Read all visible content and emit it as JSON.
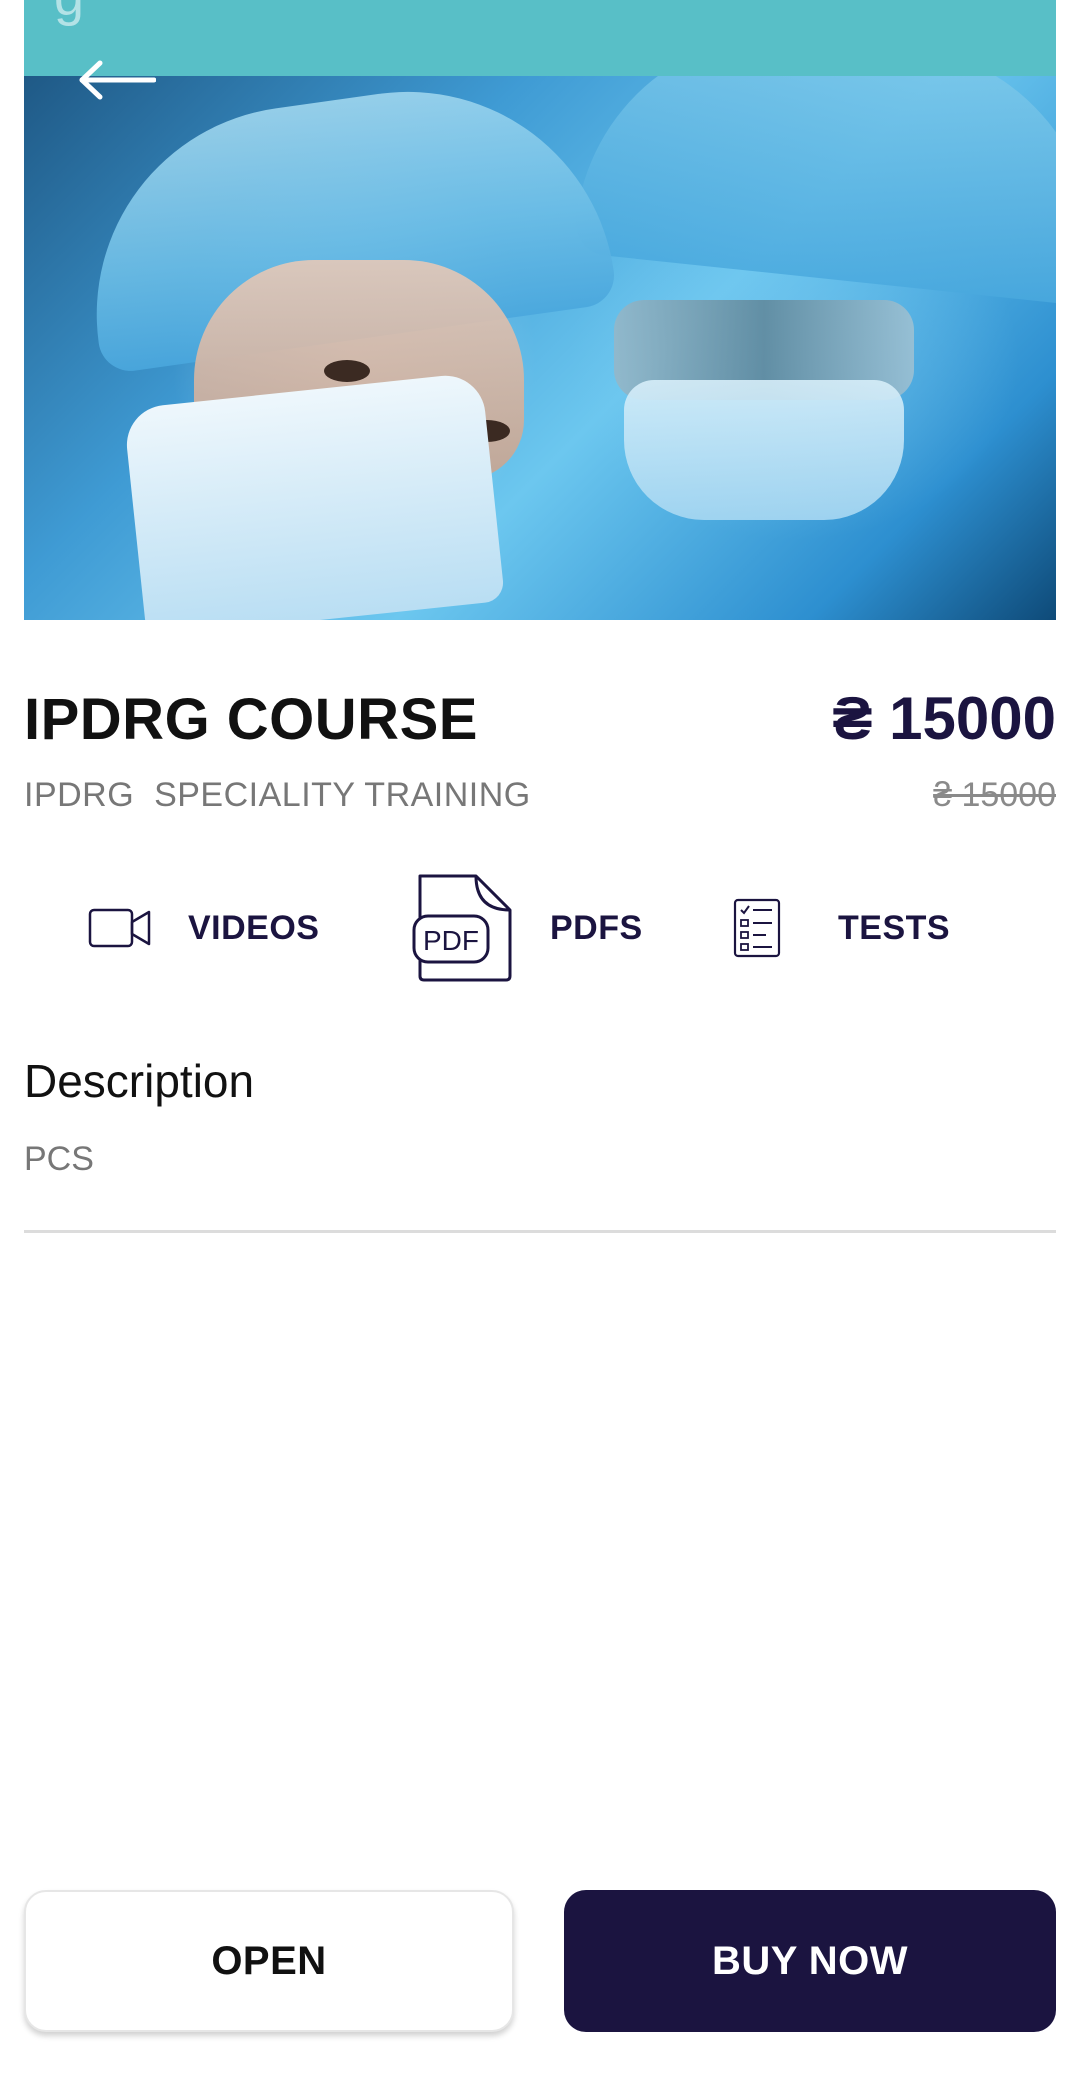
{
  "header": {
    "back_icon": "arrow-left-icon"
  },
  "course": {
    "title": "IPDRG COURSE",
    "subtitle": "IPDRG  SPECIALITY TRAINING",
    "price": "₴ 15000",
    "original_price": "₴ 15000"
  },
  "features": [
    {
      "label": "VIDEOS",
      "icon": "video-camera-icon"
    },
    {
      "label": "PDFS",
      "icon": "pdf-file-icon"
    },
    {
      "label": "TESTS",
      "icon": "checklist-icon"
    }
  ],
  "pdf_icon_text": "PDF",
  "description": {
    "heading": "Description",
    "text": "PCS"
  },
  "actions": {
    "open_label": "OPEN",
    "buy_label": "BUY NOW"
  },
  "colors": {
    "primary": "#1b1440",
    "muted_text": "#777777",
    "hero_band": "#58bfc7"
  }
}
